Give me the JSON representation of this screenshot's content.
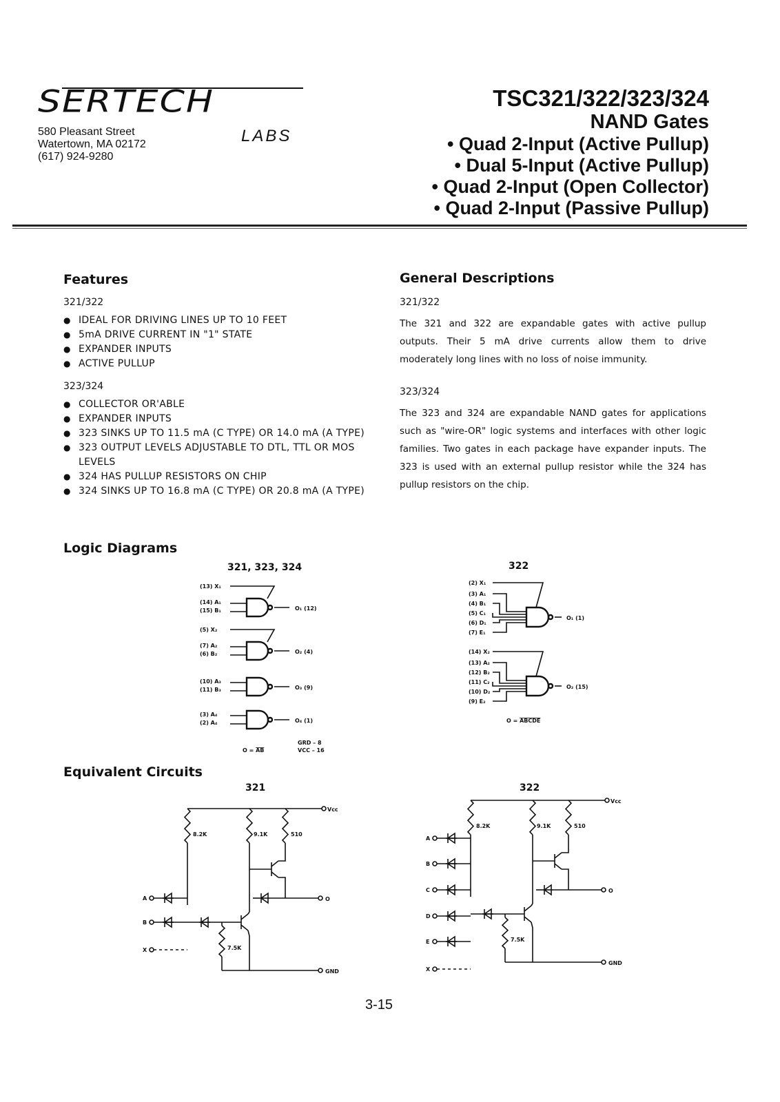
{
  "header": {
    "logo_text": "SERTECH",
    "logo_sub": "LABS",
    "address": [
      "580 Pleasant Street",
      "Watertown, MA  02172",
      "(617) 924-9280"
    ],
    "part_numbers": "TSC321/322/323/324",
    "product": "NAND Gates",
    "variants": [
      "• Quad 2-Input (Active Pullup)",
      "• Dual 5-Input (Active Pullup)",
      "• Quad 2-Input (Open Collector)",
      "• Quad 2-Input (Passive Pullup)"
    ]
  },
  "features": {
    "heading": "Features",
    "group1_title": "321/322",
    "group1": [
      "IDEAL FOR DRIVING LINES UP TO 10 FEET",
      "5mA DRIVE CURRENT IN \"1\" STATE",
      "EXPANDER INPUTS",
      "ACTIVE PULLUP"
    ],
    "group2_title": "323/324",
    "group2": [
      "COLLECTOR OR'ABLE",
      "EXPANDER INPUTS",
      "323 SINKS UP TO 11.5 mA (C TYPE) OR 14.0 mA (A TYPE)",
      "323 OUTPUT LEVELS ADJUSTABLE TO DTL, TTL OR MOS LEVELS",
      "324 HAS PULLUP RESISTORS ON CHIP",
      "324 SINKS UP TO 16.8 mA (C TYPE) OR 20.8 mA (A TYPE)"
    ]
  },
  "general": {
    "heading": "General Descriptions",
    "group1_title": "321/322",
    "group1_text": "The 321 and 322 are expandable gates with active pullup outputs. Their 5 mA drive currents allow them to drive moderately long lines with no loss of noise immunity.",
    "group2_title": "323/324",
    "group2_text": "The 323 and 324 are expandable NAND gates for applications such as \"wire-OR\" logic systems and interfaces with other logic families. Two gates in each package have expander inputs. The 323 is used with an external pullup resistor while the 324 has pullup resistors on the chip."
  },
  "logic": {
    "heading": "Logic Diagrams",
    "left": {
      "caption": "321, 323, 324",
      "labels": [
        "(13) X₁",
        "(14) A₁",
        "(15) B₁",
        "(5) X₂",
        "(7) A₂",
        "(6) B₂",
        "(10) A₃",
        "(11) B₃",
        "(3) A₄",
        "(2) A₄"
      ],
      "outputs": [
        "O₁ (12)",
        "O₂ (4)",
        "O₃ (9)",
        "O₄ (1)"
      ],
      "eq_prefix": "O = ",
      "eq_bar": "AB",
      "grd": "GRD – 8",
      "vcc": "VCC – 16"
    },
    "right": {
      "caption": "322",
      "labels": [
        "(2) X₁",
        "(3) A₁",
        "(4) B₁",
        "(5) C₁",
        "(6) D₁",
        "(7) E₁",
        "(14) X₂",
        "(13) A₂",
        "(12) B₂",
        "(11) C₂",
        "(10) D₂",
        "(9) E₂"
      ],
      "outputs": [
        "O₁ (1)",
        "O₂ (15)"
      ],
      "eq_prefix": "O = ",
      "eq_bar": "ABCDE"
    }
  },
  "equiv": {
    "heading": "Equivalent Circuits",
    "left": {
      "caption": "321",
      "vcc": "Vcc",
      "gnd": "GND",
      "out": "O",
      "r1": "8.2K",
      "r2": "9.1K",
      "r3": "510",
      "r4": "7.5K",
      "inputs": [
        "A",
        "B",
        "X"
      ]
    },
    "right": {
      "caption": "322",
      "vcc": "Vcc",
      "gnd": "GND",
      "out": "O",
      "r1": "8.2K",
      "r2": "9.1K",
      "r3": "510",
      "r4": "7.5K",
      "inputs": [
        "A",
        "B",
        "C",
        "D",
        "E",
        "X"
      ]
    }
  },
  "page_number": "3-15"
}
